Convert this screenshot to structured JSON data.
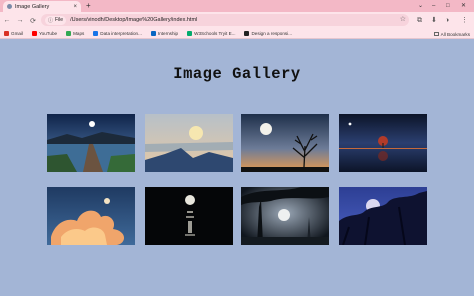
{
  "browser": {
    "tab_title": "Image Gallery",
    "tab_close": "×",
    "new_tab": "+",
    "window_controls": [
      "⌄",
      "–",
      "□",
      "✕"
    ],
    "nav": {
      "back": "←",
      "forward": "→",
      "reload": "⟳"
    },
    "omnibox": {
      "chip_label": "File",
      "chip_icon": "ⓘ",
      "url": "/Users/vinodh/Desktop/Image%20Gallery/index.html",
      "star": "☆"
    },
    "toolbar_right": [
      "⧉",
      "⬇",
      "◑",
      "⋮"
    ]
  },
  "bookmarks": {
    "items": [
      {
        "label": "Gmail",
        "color": "#d93025"
      },
      {
        "label": "YouTube",
        "color": "#ff0000"
      },
      {
        "label": "Maps",
        "color": "#34a853"
      },
      {
        "label": "Data interpretation...",
        "color": "#1a73e8"
      },
      {
        "label": "Internship",
        "color": "#0a66c2"
      },
      {
        "label": "W3Schools Tryit E...",
        "color": "#04aa6d"
      },
      {
        "label": "Design a responsi...",
        "color": "#222222"
      }
    ],
    "all_label": "All Bookmarks"
  },
  "page": {
    "title": "Image Gallery"
  },
  "gallery": [
    {
      "name": "pier-moon-photo",
      "alt": "Pier under moonlit sky"
    },
    {
      "name": "mountain-moonrise-photo",
      "alt": "Moon rising over mountains"
    },
    {
      "name": "bare-tree-moon-photo",
      "alt": "Bare tree silhouette with moon at sunset"
    },
    {
      "name": "lake-tree-reflection-photo",
      "alt": "Tree reflected in lake at night"
    },
    {
      "name": "orange-clouds-moon-photo",
      "alt": "Moon over orange clouds"
    },
    {
      "name": "moon-over-sea-photo",
      "alt": "Moon reflecting over dark sea"
    },
    {
      "name": "misty-forest-moon-photo",
      "alt": "Misty forest with moon"
    },
    {
      "name": "moonlit-tree-branches-photo",
      "alt": "Full moon behind tree branches"
    }
  ]
}
